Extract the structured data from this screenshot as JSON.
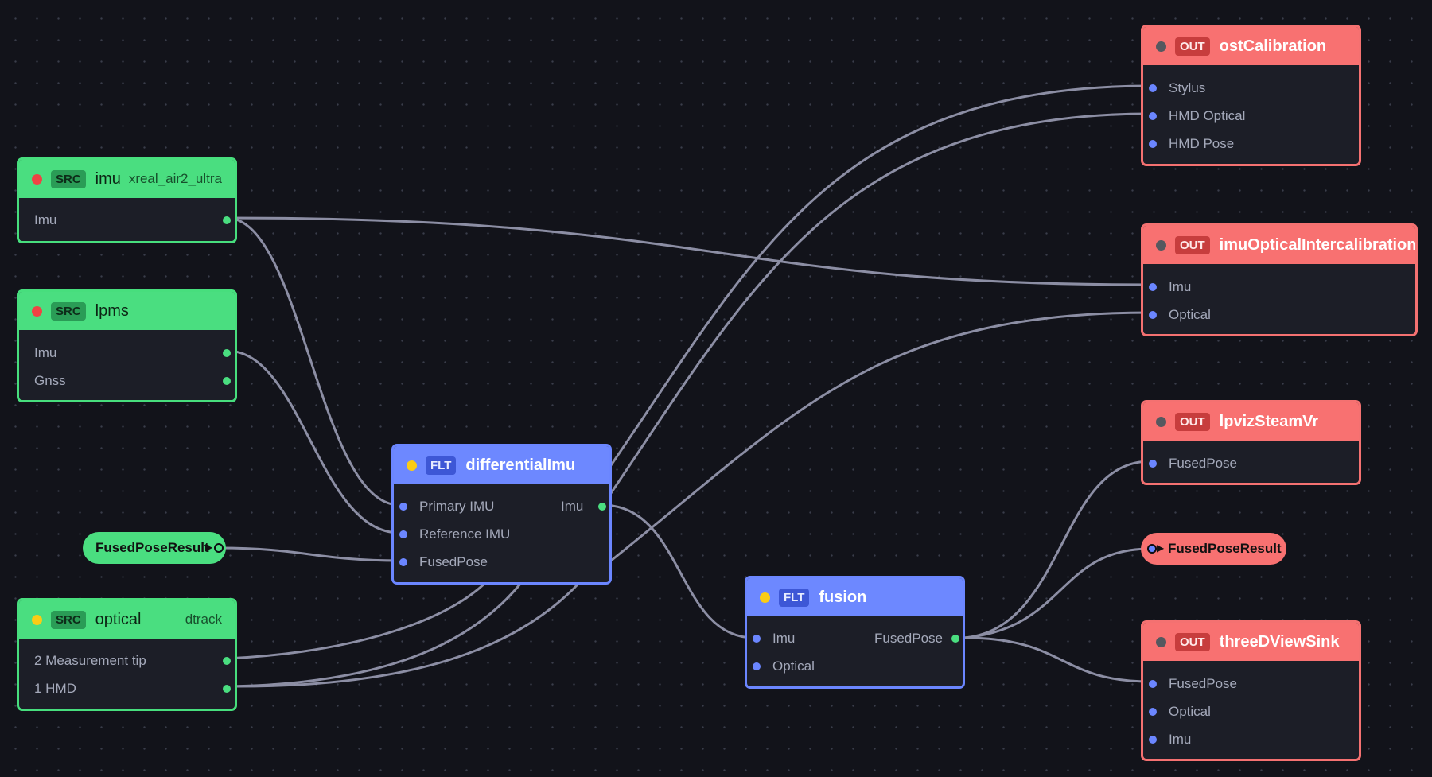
{
  "nodes": {
    "imu": {
      "type": "SRC",
      "name": "imu",
      "subtitle": "xreal_air2_ultra",
      "outputs": [
        "Imu"
      ]
    },
    "lpms": {
      "type": "SRC",
      "name": "lpms",
      "outputs": [
        "Imu",
        "Gnss"
      ]
    },
    "optical": {
      "type": "SRC",
      "name": "optical",
      "subtitle": "dtrack",
      "outputs": [
        "2 Measurement tip",
        "1 HMD"
      ]
    },
    "differentialImu": {
      "type": "FLT",
      "name": "differentialImu",
      "inputs": [
        "Primary IMU",
        "Reference IMU",
        "FusedPose"
      ],
      "outputs": [
        "Imu"
      ]
    },
    "fusion": {
      "type": "FLT",
      "name": "fusion",
      "inputs": [
        "Imu",
        "Optical"
      ],
      "outputs": [
        "FusedPose"
      ]
    },
    "ostCalibration": {
      "type": "OUT",
      "name": "ostCalibration",
      "inputs": [
        "Stylus",
        "HMD Optical",
        "HMD Pose"
      ]
    },
    "imuOpticalIntercalibration": {
      "type": "OUT",
      "name": "imuOpticalIntercalibration",
      "inputs": [
        "Imu",
        "Optical"
      ]
    },
    "lpvizSteamVr": {
      "type": "OUT",
      "name": "lpvizSteamVr",
      "inputs": [
        "FusedPose"
      ]
    },
    "threeDViewSink": {
      "type": "OUT",
      "name": "threeDViewSink",
      "inputs": [
        "FusedPose",
        "Optical",
        "Imu"
      ]
    }
  },
  "pills": {
    "source": {
      "label": "FusedPoseResult"
    },
    "sink": {
      "label": "FusedPoseResult"
    }
  },
  "colors": {
    "background": "#12131a",
    "src": "#4ade80",
    "flt": "#6d88ff",
    "out": "#f87171",
    "wire": "#9a9cb4",
    "status_error": "#ef4444",
    "status_pending": "#facc15",
    "status_idle": "#55585f"
  },
  "icons": {
    "status": "status-dot-icon",
    "pill_arrow": "play-arrow-icon"
  }
}
